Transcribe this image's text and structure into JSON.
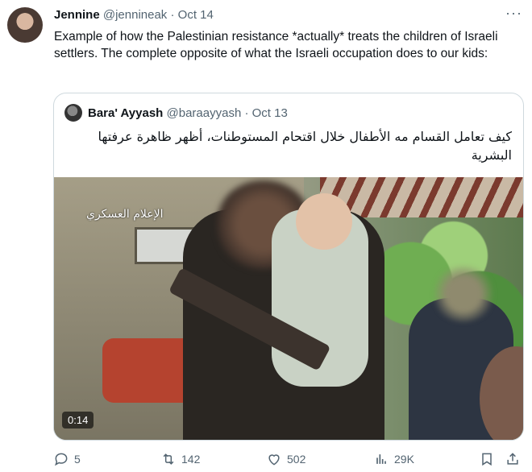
{
  "author": {
    "name": "Jennine",
    "handle": "@jennineak",
    "separator": "·",
    "date": "Oct 14"
  },
  "tweet_text": "Example of how the Palestinian resistance *actually* treats the children of Israeli settlers. The complete opposite of what the Israeli occupation does to our kids:",
  "quote": {
    "author": {
      "name": "Bara' Ayyash",
      "handle": "@baraayyash",
      "separator": "·",
      "date": "Oct 13"
    },
    "text": "كيف تعامل القسام مه الأطفال خلال اقتحام المستوطنات، أظهر ظاهرة عرفتها البشرية",
    "media": {
      "logo_text": "الإعلام العسكري",
      "duration": "0:14"
    }
  },
  "actions": {
    "replies": "5",
    "retweets": "142",
    "likes": "502",
    "views": "29K"
  },
  "icons": [
    "more-icon",
    "reply-icon",
    "retweet-icon",
    "like-icon",
    "views-icon",
    "bookmark-icon",
    "share-icon"
  ],
  "colors": {
    "text": "#0f1419",
    "muted": "#536471",
    "border": "#cfd9de"
  }
}
